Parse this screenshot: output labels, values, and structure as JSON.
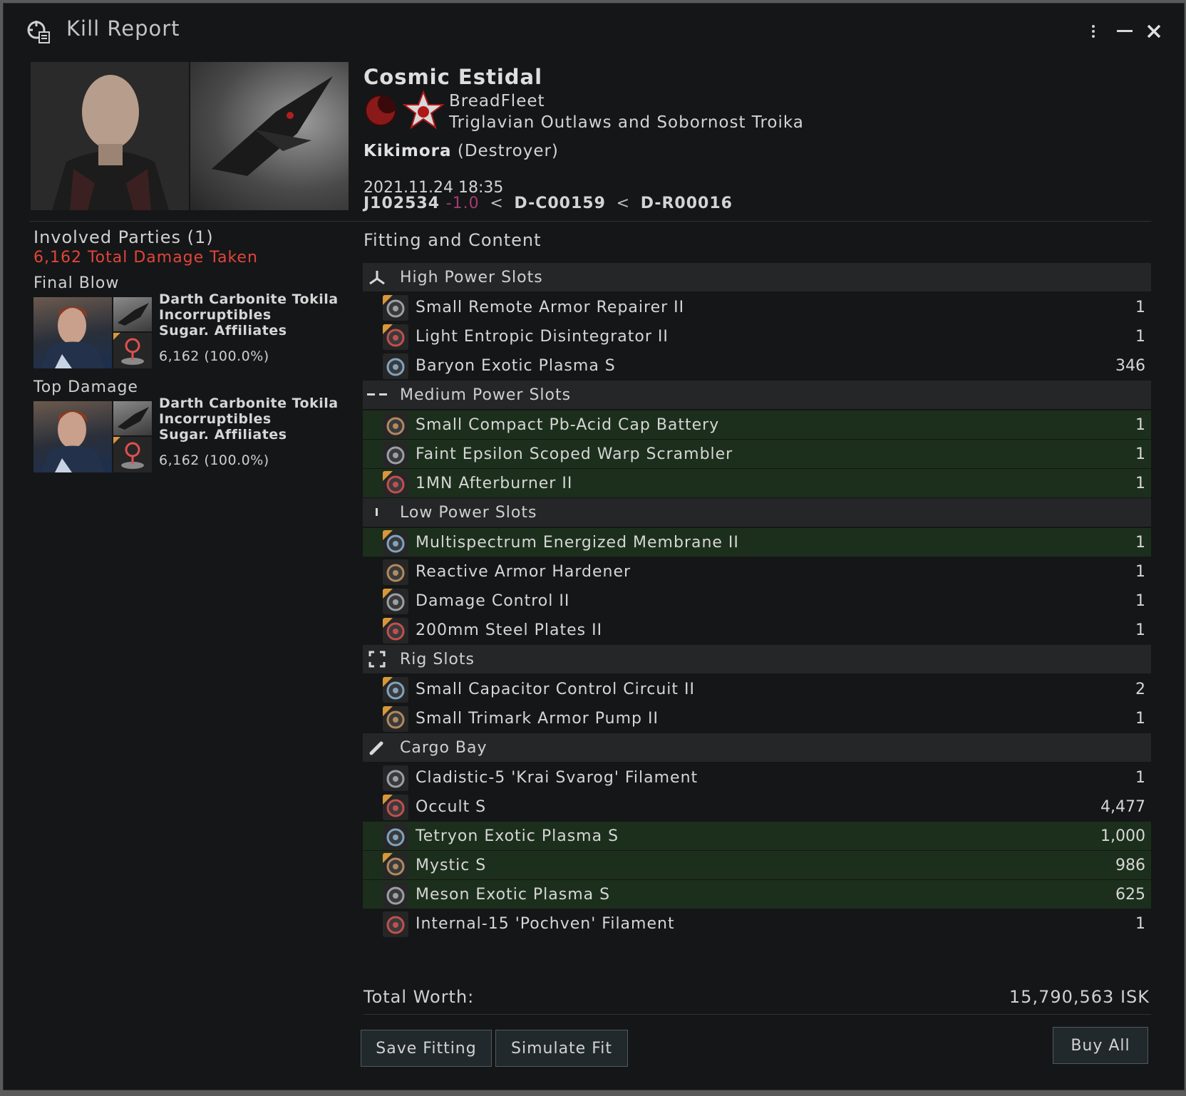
{
  "window": {
    "title": "Kill Report",
    "icons": [
      "kill-report-icon",
      "more-icon",
      "minimize-icon",
      "close-icon"
    ]
  },
  "victim": {
    "name": "Cosmic Estidal",
    "corporation": "BreadFleet",
    "alliance": "Triglavian Outlaws and Sobornost Troika",
    "ship": "Kikimora",
    "ship_class": "(Destroyer)",
    "datetime": "2021.11.24 18:35",
    "system": "J102534",
    "security": "-1.0",
    "constellation": "D-C00159",
    "region": "D-R00016",
    "sep": "<"
  },
  "involved": {
    "title": "Involved Parties (1)",
    "total_damage": "6,162 Total Damage Taken",
    "final_blow_label": "Final Blow",
    "top_damage_label": "Top Damage",
    "final_blow": {
      "name": "Darth Carbonite Tokila",
      "corp": "Incorruptibles",
      "alliance": "Sugar. Affiliates",
      "damage": "6,162 (100.0%)"
    },
    "top_damage": {
      "name": "Darth Carbonite Tokila",
      "corp": "Incorruptibles",
      "alliance": "Sugar. Affiliates",
      "damage": "6,162 (100.0%)"
    }
  },
  "fitting": {
    "title": "Fitting and Content",
    "groups": [
      {
        "label": "High Power Slots",
        "icon": "high-slot-icon",
        "items": [
          {
            "name": "Small Remote Armor Repairer II",
            "qty": "1",
            "dropped": false,
            "tier": true
          },
          {
            "name": "Light Entropic Disintegrator II",
            "qty": "1",
            "dropped": false,
            "tier": true
          },
          {
            "name": "Baryon Exotic Plasma S",
            "qty": "346",
            "dropped": false,
            "tier": false
          }
        ]
      },
      {
        "label": "Medium Power Slots",
        "icon": "mid-slot-icon",
        "items": [
          {
            "name": "Small Compact Pb-Acid Cap Battery",
            "qty": "1",
            "dropped": true,
            "tier": false
          },
          {
            "name": "Faint Epsilon Scoped Warp Scrambler",
            "qty": "1",
            "dropped": true,
            "tier": false
          },
          {
            "name": "1MN Afterburner II",
            "qty": "1",
            "dropped": true,
            "tier": true
          }
        ]
      },
      {
        "label": "Low Power Slots",
        "icon": "low-slot-icon",
        "items": [
          {
            "name": "Multispectrum Energized Membrane II",
            "qty": "1",
            "dropped": true,
            "tier": true
          },
          {
            "name": "Reactive Armor Hardener",
            "qty": "1",
            "dropped": false,
            "tier": false
          },
          {
            "name": "Damage Control II",
            "qty": "1",
            "dropped": false,
            "tier": true
          },
          {
            "name": "200mm Steel Plates II",
            "qty": "1",
            "dropped": false,
            "tier": true
          }
        ]
      },
      {
        "label": "Rig Slots",
        "icon": "rig-slot-icon",
        "items": [
          {
            "name": "Small Capacitor Control Circuit II",
            "qty": "2",
            "dropped": false,
            "tier": true
          },
          {
            "name": "Small Trimark Armor Pump II",
            "qty": "1",
            "dropped": false,
            "tier": true
          }
        ]
      },
      {
        "label": "Cargo Bay",
        "icon": "cargo-icon",
        "items": [
          {
            "name": "Cladistic-5 'Krai Svarog' Filament",
            "qty": "1",
            "dropped": false,
            "tier": false
          },
          {
            "name": "Occult S",
            "qty": "4,477",
            "dropped": false,
            "tier": true
          },
          {
            "name": "Tetryon Exotic Plasma S",
            "qty": "1,000",
            "dropped": true,
            "tier": false
          },
          {
            "name": "Mystic S",
            "qty": "986",
            "dropped": true,
            "tier": true
          },
          {
            "name": "Meson Exotic Plasma S",
            "qty": "625",
            "dropped": true,
            "tier": false
          },
          {
            "name": "Internal-15 'Pochven' Filament",
            "qty": "1",
            "dropped": false,
            "tier": false
          }
        ]
      }
    ],
    "total_worth_label": "Total Worth:",
    "total_worth_value": "15,790,563 ISK"
  },
  "buttons": {
    "save_fitting": "Save Fitting",
    "simulate_fit": "Simulate Fit",
    "buy_all": "Buy All"
  },
  "colors": {
    "dropped_row": "#1c2f1c",
    "group_header": "#242628",
    "damage_red": "#e0453b",
    "security": "#a43c74",
    "tier_badge": "#d8983a"
  }
}
